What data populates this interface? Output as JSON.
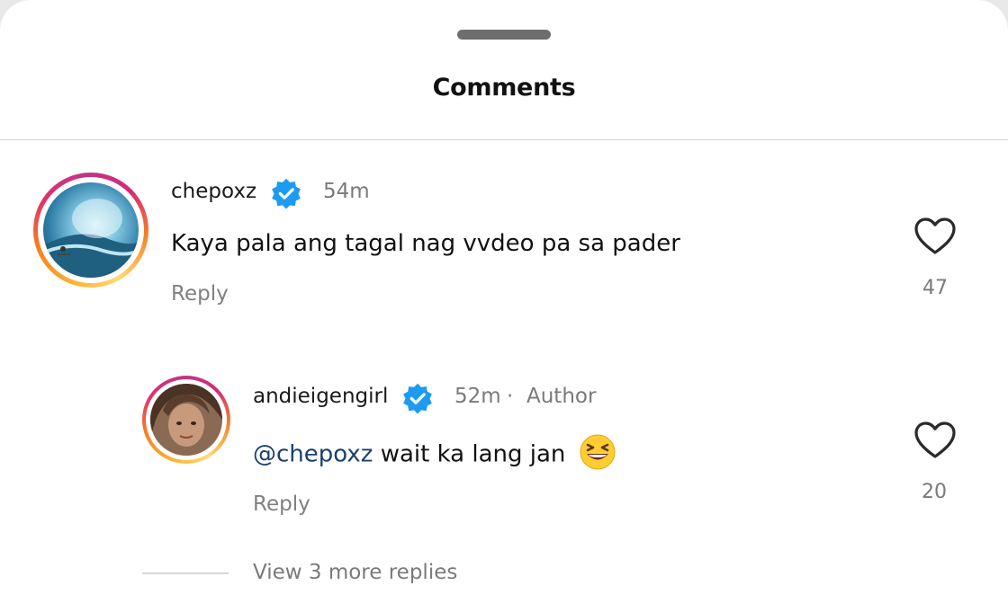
{
  "sheet": {
    "title": "Comments"
  },
  "comments": [
    {
      "username": "chepoxz",
      "verified": true,
      "time": "54m",
      "text": "Kaya pala ang tagal nag vvdeo pa sa pader",
      "reply_label": "Reply",
      "likes": "47",
      "avatar": "surf-wave-avatar"
    }
  ],
  "replies": [
    {
      "username": "andieigengirl",
      "verified": true,
      "time": "52m",
      "separator": "·",
      "author_badge": "Author",
      "mention": "@chepoxz",
      "text": "wait ka lang jan",
      "emoji": "grinning-squinting-face",
      "reply_label": "Reply",
      "likes": "20",
      "avatar": "woman-portrait-avatar"
    }
  ],
  "thread": {
    "view_more_label": "View 3 more replies"
  },
  "colors": {
    "verified_blue": "#1d9bf0",
    "mention": "#1d3f6e",
    "muted": "#7a7a7a"
  }
}
